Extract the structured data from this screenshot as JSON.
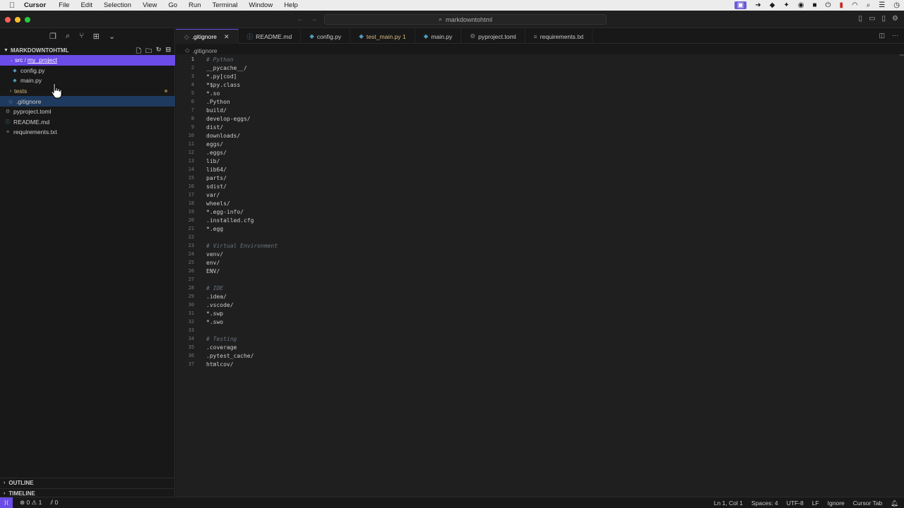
{
  "menubar": {
    "app": "Cursor",
    "items": [
      "File",
      "Edit",
      "Selection",
      "View",
      "Go",
      "Run",
      "Terminal",
      "Window",
      "Help"
    ]
  },
  "titlebar": {
    "search": "markdowntohtml"
  },
  "explorer": {
    "title": "MARKDOWNTOHTML",
    "folder_src": "src",
    "folder_project": "my_project",
    "items": [
      {
        "label": "config.py"
      },
      {
        "label": "main.py"
      },
      {
        "label": "tests"
      },
      {
        "label": ".gitignore"
      },
      {
        "label": "pyproject.toml"
      },
      {
        "label": "README.md"
      },
      {
        "label": "requirements.txt"
      }
    ],
    "outline": "OUTLINE",
    "timeline": "TIMELINE"
  },
  "tabs": [
    {
      "label": ".gitignore"
    },
    {
      "label": "README.md"
    },
    {
      "label": "config.py"
    },
    {
      "label": "test_main.py 1"
    },
    {
      "label": "main.py"
    },
    {
      "label": "pyproject.toml"
    },
    {
      "label": "requirements.txt"
    }
  ],
  "breadcrumb": ".gitignore",
  "editor": {
    "lines": [
      "# Python",
      "__pycache__/",
      "*.py[cod]",
      "*$py.class",
      "*.so",
      ".Python",
      "build/",
      "develop-eggs/",
      "dist/",
      "downloads/",
      "eggs/",
      ".eggs/",
      "lib/",
      "lib64/",
      "parts/",
      "sdist/",
      "var/",
      "wheels/",
      "*.egg-info/",
      ".installed.cfg",
      "*.egg",
      "",
      "# Virtual Environment",
      "venv/",
      "env/",
      "ENV/",
      "",
      "# IDE",
      ".idea/",
      ".vscode/",
      "*.swp",
      "*.swo",
      "",
      "# Testing",
      ".coverage",
      ".pytest_cache/",
      "htmlcov/"
    ]
  },
  "status": {
    "errors": "0",
    "warnings": "1",
    "ports": "0",
    "position": "Ln 1, Col 1",
    "spaces": "Spaces: 4",
    "encoding": "UTF-8",
    "eol": "LF",
    "language": "Ignore",
    "cursor_tab": "Cursor Tab"
  }
}
